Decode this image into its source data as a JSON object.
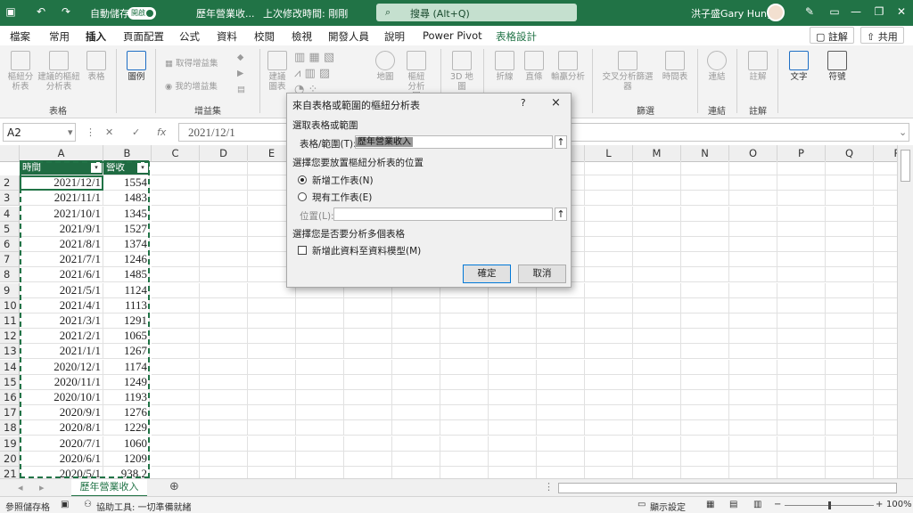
{
  "titlebar": {
    "autosave_label": "自動儲存",
    "autosave_state": "開啟",
    "doc_title": "歷年營業收...",
    "last_modified": "上次修改時間: 剛剛",
    "search_placeholder": "搜尋 (Alt+Q)",
    "user_name": "洪子盛Gary Hung",
    "accent": "#217346"
  },
  "tabs": [
    "檔案",
    "常用",
    "插入",
    "頁面配置",
    "公式",
    "資料",
    "校閱",
    "檢視",
    "開發人員",
    "說明",
    "Power Pivot",
    "表格設計"
  ],
  "active_tab": "插入",
  "right_buttons": {
    "comment": "註解",
    "share": "共用"
  },
  "ribbon": {
    "pivot": "樞紐分析表",
    "recommended_pivot": "建議的樞紐分析表",
    "table": "表格",
    "illustrations": "圖例",
    "get_addins": "取得增益集",
    "my_addins": "我的增益集",
    "rec_charts": "建議圖表",
    "maps": "地圖",
    "pivot_chart": "樞紐分析圖",
    "map3d": "3D 地圖",
    "line": "折線",
    "column": "直條",
    "win_loss": "輸贏分析",
    "slicer": "交叉分析篩選器",
    "timeline": "時間表",
    "link": "連結",
    "comment": "註解",
    "text": "文字",
    "symbols": "符號",
    "groups": {
      "tables": "表格",
      "addins": "增益集",
      "filters": "篩選",
      "links": "連結",
      "comments": "註解"
    }
  },
  "formula_bar": {
    "name_box": "A2",
    "value": "2021/12/1"
  },
  "columns": [
    "A",
    "B",
    "C",
    "D",
    "E",
    "F",
    "G",
    "H",
    "I",
    "J",
    "K",
    "L",
    "M",
    "N",
    "O",
    "P",
    "Q",
    "R"
  ],
  "table": {
    "headers": [
      "時間",
      "營收"
    ],
    "rows": [
      {
        "row": "2",
        "date": "2021/12/1",
        "value": "1554"
      },
      {
        "row": "3",
        "date": "2021/11/1",
        "value": "1483"
      },
      {
        "row": "4",
        "date": "2021/10/1",
        "value": "1345"
      },
      {
        "row": "5",
        "date": "2021/9/1",
        "value": "1527"
      },
      {
        "row": "6",
        "date": "2021/8/1",
        "value": "1374"
      },
      {
        "row": "7",
        "date": "2021/7/1",
        "value": "1246"
      },
      {
        "row": "8",
        "date": "2021/6/1",
        "value": "1485"
      },
      {
        "row": "9",
        "date": "2021/5/1",
        "value": "1124"
      },
      {
        "row": "10",
        "date": "2021/4/1",
        "value": "1113"
      },
      {
        "row": "11",
        "date": "2021/3/1",
        "value": "1291"
      },
      {
        "row": "12",
        "date": "2021/2/1",
        "value": "1065"
      },
      {
        "row": "13",
        "date": "2021/1/1",
        "value": "1267"
      },
      {
        "row": "14",
        "date": "2020/12/1",
        "value": "1174"
      },
      {
        "row": "15",
        "date": "2020/11/1",
        "value": "1249"
      },
      {
        "row": "16",
        "date": "2020/10/1",
        "value": "1193"
      },
      {
        "row": "17",
        "date": "2020/9/1",
        "value": "1276"
      },
      {
        "row": "18",
        "date": "2020/8/1",
        "value": "1229"
      },
      {
        "row": "19",
        "date": "2020/7/1",
        "value": "1060"
      },
      {
        "row": "20",
        "date": "2020/6/1",
        "value": "1209"
      },
      {
        "row": "21",
        "date": "2020/5/1",
        "value": "938.2"
      }
    ]
  },
  "dialog": {
    "title": "來自表格或範圍的樞紐分析表",
    "help": "?",
    "close": "×",
    "section1": "選取表格或範圍",
    "range_label": "表格/範圍(T):",
    "range_value": "歷年營業收入",
    "section2": "選擇您要放置樞紐分析表的位置",
    "opt_new": "新增工作表(N)",
    "opt_existing": "現有工作表(E)",
    "location_label": "位置(L):",
    "location_value": "",
    "section3": "選擇您是否要分析多個表格",
    "add_model": "新增此資料至資料模型(M)",
    "ok": "確定",
    "cancel": "取消"
  },
  "sheet_tab": "歷年營業收入",
  "status": {
    "ready": "參照儲存格",
    "accessibility": "協助工具: 一切準備就緒",
    "display_settings": "顯示設定",
    "zoom": "100%"
  }
}
